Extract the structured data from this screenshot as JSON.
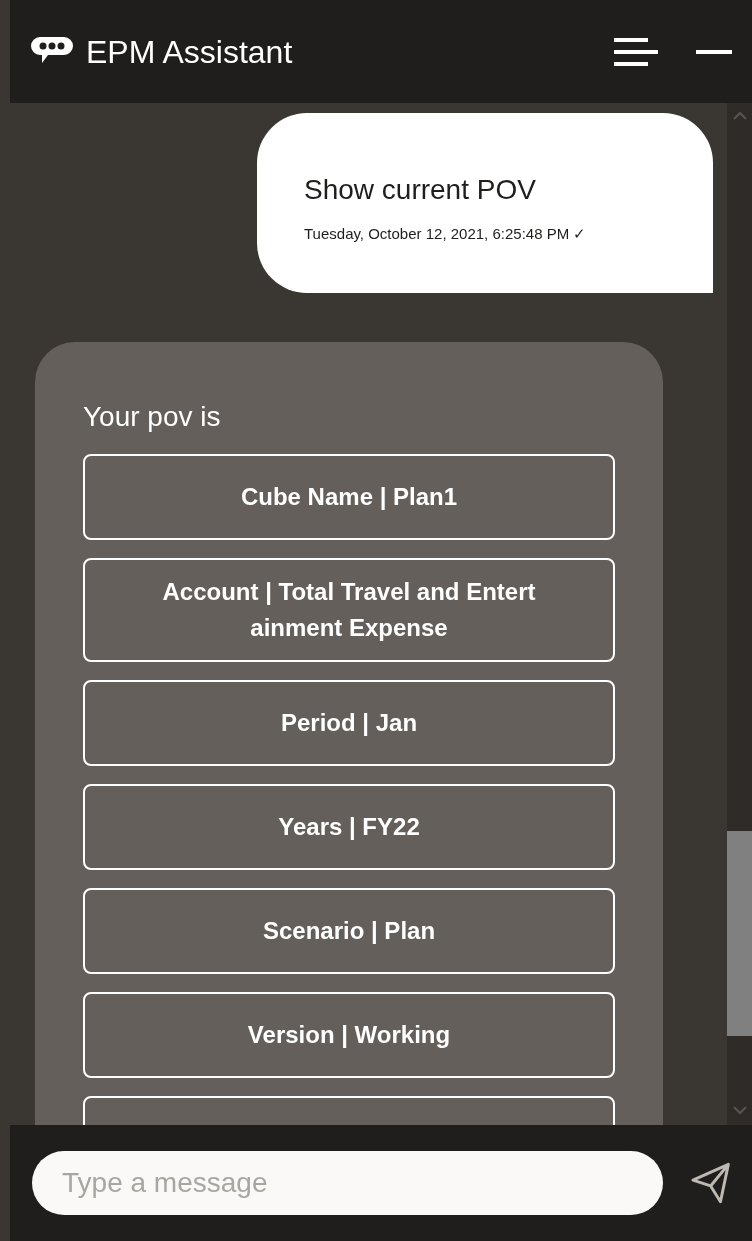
{
  "window": {
    "title": "EPM Assistant"
  },
  "messages": [
    {
      "kind": "user",
      "text": "Show current POV",
      "timestamp": "Tuesday, October 12, 2021, 6:25:48 PM ✓"
    },
    {
      "kind": "bot",
      "text": "Your pov is",
      "actions": [
        "Cube Name | Plan1",
        "Account | Total Travel and Entert ainment Expense",
        "Period | Jan",
        "Years | FY22",
        "Scenario | Plan",
        "Version | Working"
      ],
      "cut_off_option": true
    }
  ],
  "composer": {
    "placeholder": "Type a message"
  }
}
